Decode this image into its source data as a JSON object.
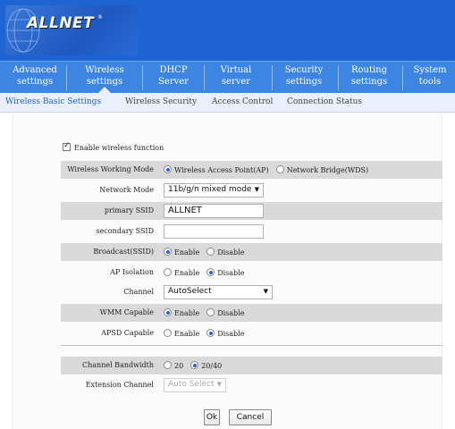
{
  "brand": {
    "name": "ALLNET",
    "mark": "®"
  },
  "nav": {
    "items": [
      {
        "line1": "Advanced",
        "line2": "settings"
      },
      {
        "line1": "Wireless",
        "line2": "settings"
      },
      {
        "line1": "DHCP",
        "line2": "Server"
      },
      {
        "line1": "Virtual",
        "line2": "server"
      },
      {
        "line1": "Security",
        "line2": "settings"
      },
      {
        "line1": "Routing",
        "line2": "settings"
      },
      {
        "line1": "System",
        "line2": "tools"
      }
    ],
    "active_index": 1
  },
  "subnav": {
    "items": [
      "Wireless Basic Settings",
      "Wireless Security",
      "Access Control",
      "Connection Status"
    ],
    "active_index": 0
  },
  "form": {
    "enable_wireless": {
      "label": "Enable wireless function",
      "checked": true
    },
    "working_mode": {
      "label": "Wireless Working Mode",
      "options": [
        "Wireless Access Point(AP)",
        "Network Bridge(WDS)"
      ],
      "selected": 0
    },
    "network_mode": {
      "label": "Network Mode",
      "value": "11b/g/n mixed mode"
    },
    "primary_ssid": {
      "label": "primary SSID",
      "value": "ALLNET"
    },
    "secondary_ssid": {
      "label": "secondary SSID",
      "value": ""
    },
    "broadcast_ssid": {
      "label": "Broadcast(SSID)",
      "options": [
        "Enable",
        "Disable"
      ],
      "selected": 0
    },
    "ap_isolation": {
      "label": "AP Isolation",
      "options": [
        "Enable",
        "Disable"
      ],
      "selected": 1
    },
    "channel": {
      "label": "Channel",
      "value": "AutoSelect"
    },
    "wmm": {
      "label": "WMM Capable",
      "options": [
        "Enable",
        "Disable"
      ],
      "selected": 0
    },
    "apsd": {
      "label": "APSD Capable",
      "options": [
        "Enable",
        "Disable"
      ],
      "selected": 1
    },
    "bandwidth": {
      "label": "Channel Bandwidth",
      "options": [
        "20",
        "20/40"
      ],
      "selected": 1
    },
    "ext_channel": {
      "label": "Extension Channel",
      "value": "Auto Select"
    }
  },
  "buttons": {
    "ok": "Ok",
    "cancel": "Cancel"
  },
  "colors": {
    "header": "#1e64d2",
    "nav": "#3c85e2",
    "subnav": "#e9f0fb",
    "shaded_row": "#d9d9d9"
  }
}
